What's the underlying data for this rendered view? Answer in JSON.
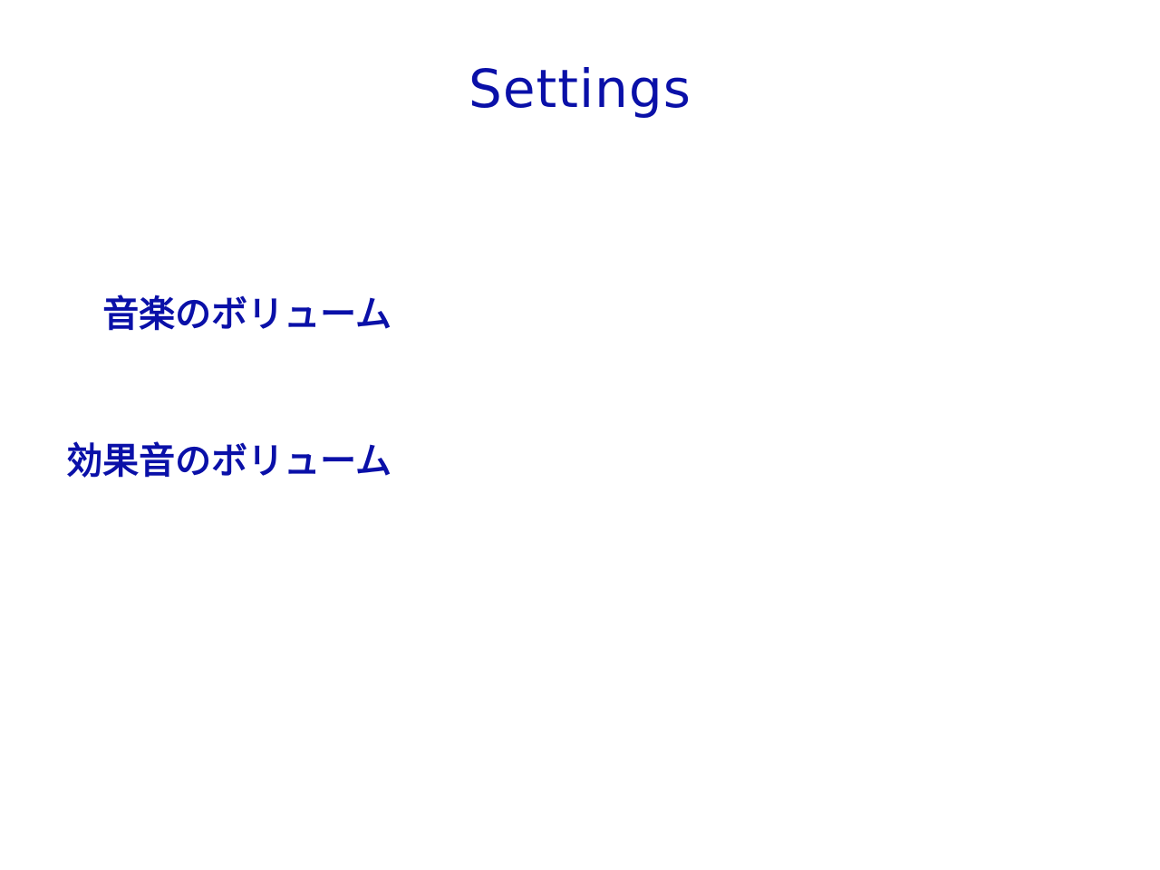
{
  "title": "Settings",
  "settings": {
    "music_volume_label": "音楽のボリューム",
    "sfx_volume_label": "効果音のボリューム"
  },
  "colors": {
    "text": "#0a10a8",
    "background": "#ffffff"
  }
}
